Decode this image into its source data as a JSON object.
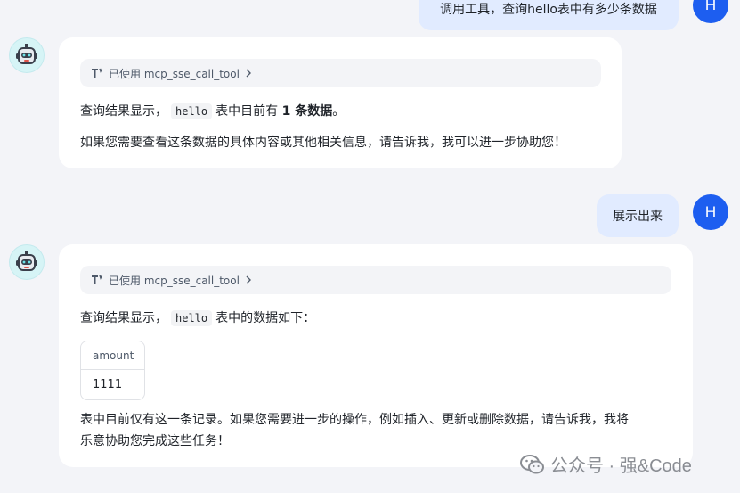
{
  "conversation": [
    {
      "user": {
        "text": "调用工具，查询hello表中有多少条数据",
        "avatar_letter": "H"
      },
      "bot": {
        "tool_label": "已使用 mcp_sse_call_tool",
        "line1_prefix": "查询结果显示，",
        "line1_code": "hello",
        "line1_mid": "表中目前有 ",
        "line1_bold": "1 条数据",
        "line1_suffix": "。",
        "line2": "如果您需要查看这条数据的具体内容或其他相关信息，请告诉我，我可以进一步协助您！"
      }
    },
    {
      "user": {
        "text": "展示出来",
        "avatar_letter": "H"
      },
      "bot": {
        "tool_label": "已使用 mcp_sse_call_tool",
        "line1_prefix": "查询结果显示，",
        "line1_code": "hello",
        "line1_suffix": "表中的数据如下：",
        "table": {
          "header": "amount",
          "value": "1111"
        },
        "closing_line1": "表中目前仅有这一条记录。如果您需要进一步的操作，例如插入、更新或删除数据，请告诉我，我将",
        "closing_line2": "乐意协助您完成这些任务！"
      }
    }
  ],
  "watermark": {
    "text": "公众号 · 强&Code",
    "icon": "wechat-icon"
  },
  "colors": {
    "background": "#f3f4f8",
    "user_bubble": "#e1ebff",
    "user_avatar": "#1d5ef0",
    "bot_avatar_bg": "#d6f4f6"
  }
}
